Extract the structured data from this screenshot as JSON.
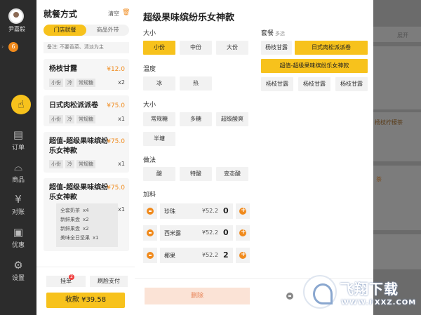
{
  "nav": {
    "user_name": "尹嘉毅",
    "badge_count": "6",
    "items": [
      {
        "label": "订单",
        "icon": "orders-icon"
      },
      {
        "label": "商品",
        "icon": "dish-icon"
      },
      {
        "label": "对账",
        "icon": "reconcile-icon"
      },
      {
        "label": "优惠",
        "icon": "wallet-icon"
      },
      {
        "label": "设置",
        "icon": "gear-icon"
      }
    ]
  },
  "order": {
    "title": "就餐方式",
    "clear_label": "清空",
    "tabs": [
      "门店就餐",
      "商品外带"
    ],
    "note_placeholder": "备注: 不要香菜、清淡为主",
    "items": [
      {
        "name": "杨枝甘露",
        "price": "¥12.0",
        "tags": [
          "小份",
          "冷",
          "常规糖"
        ],
        "qty": "x2"
      },
      {
        "name": "日式肉松派派卷",
        "price": "¥75.0",
        "tags": [
          "小份",
          "冷",
          "常规糖"
        ],
        "qty": "x1"
      },
      {
        "name_line1": "超值-超级果味缤纷",
        "name_line2": "乐女神款",
        "price": "¥75.0",
        "tags": [
          "小份",
          "冷",
          "常规糖"
        ],
        "qty": "x1"
      },
      {
        "name_line1": "超值-超级果味缤纷",
        "name_line2": "乐女神款",
        "price": "¥75.0",
        "qty": "x1",
        "sub_items": [
          {
            "name": "全套奶茶",
            "qty": "x4"
          },
          {
            "name": "新鲜果盘",
            "qty": "x2"
          },
          {
            "name": "新鲜果盘",
            "qty": "x2"
          },
          {
            "name": "美味全日坚果",
            "qty": "x1"
          }
        ]
      }
    ],
    "hold_label": "挂单",
    "hold_badge": "2",
    "face_pay_label": "刷脸支付",
    "pay_label": "收款 ¥39.58"
  },
  "modal": {
    "title": "超级果味缤纷乐女神款",
    "sections": {
      "size": {
        "label": "大小",
        "options": [
          "小份",
          "中份",
          "大份"
        ],
        "selected": "小份"
      },
      "temp": {
        "label": "温度",
        "options": [
          "冰",
          "热"
        ]
      },
      "sugar": {
        "label": "大小",
        "options": [
          "常规糖",
          "多糖",
          "超级酸爽",
          "半塘"
        ]
      },
      "method": {
        "label": "做法",
        "options": [
          "酸",
          "特酸",
          "变态酸"
        ]
      },
      "addons": {
        "label": "加料",
        "items": [
          {
            "name": "珍珠",
            "price": "¥52.2",
            "qty": "0"
          },
          {
            "name": "西米露",
            "price": "¥52.2",
            "qty": "0"
          },
          {
            "name": "椰果",
            "price": "¥52.2",
            "qty": "2"
          }
        ]
      },
      "combo": {
        "label": "套餐",
        "hint": "多选",
        "options": [
          "杨枝甘露",
          "日式肉松派派卷",
          "超值-超级果味缤纷乐女神款",
          "杨枝甘露",
          "杨枝甘露",
          "杨枝甘露"
        ]
      }
    },
    "delete_label": "删除"
  },
  "background": {
    "collapse_label": "展开",
    "item_text": "杨枝柠檬茶",
    "item_text2": "茶"
  },
  "watermark": {
    "title": "飞翔下载",
    "url": "WWW.FXXZ.COM"
  },
  "colors": {
    "accent": "#f7c21c",
    "price": "#f08a1c",
    "nav_bg": "#2c2c2c"
  }
}
